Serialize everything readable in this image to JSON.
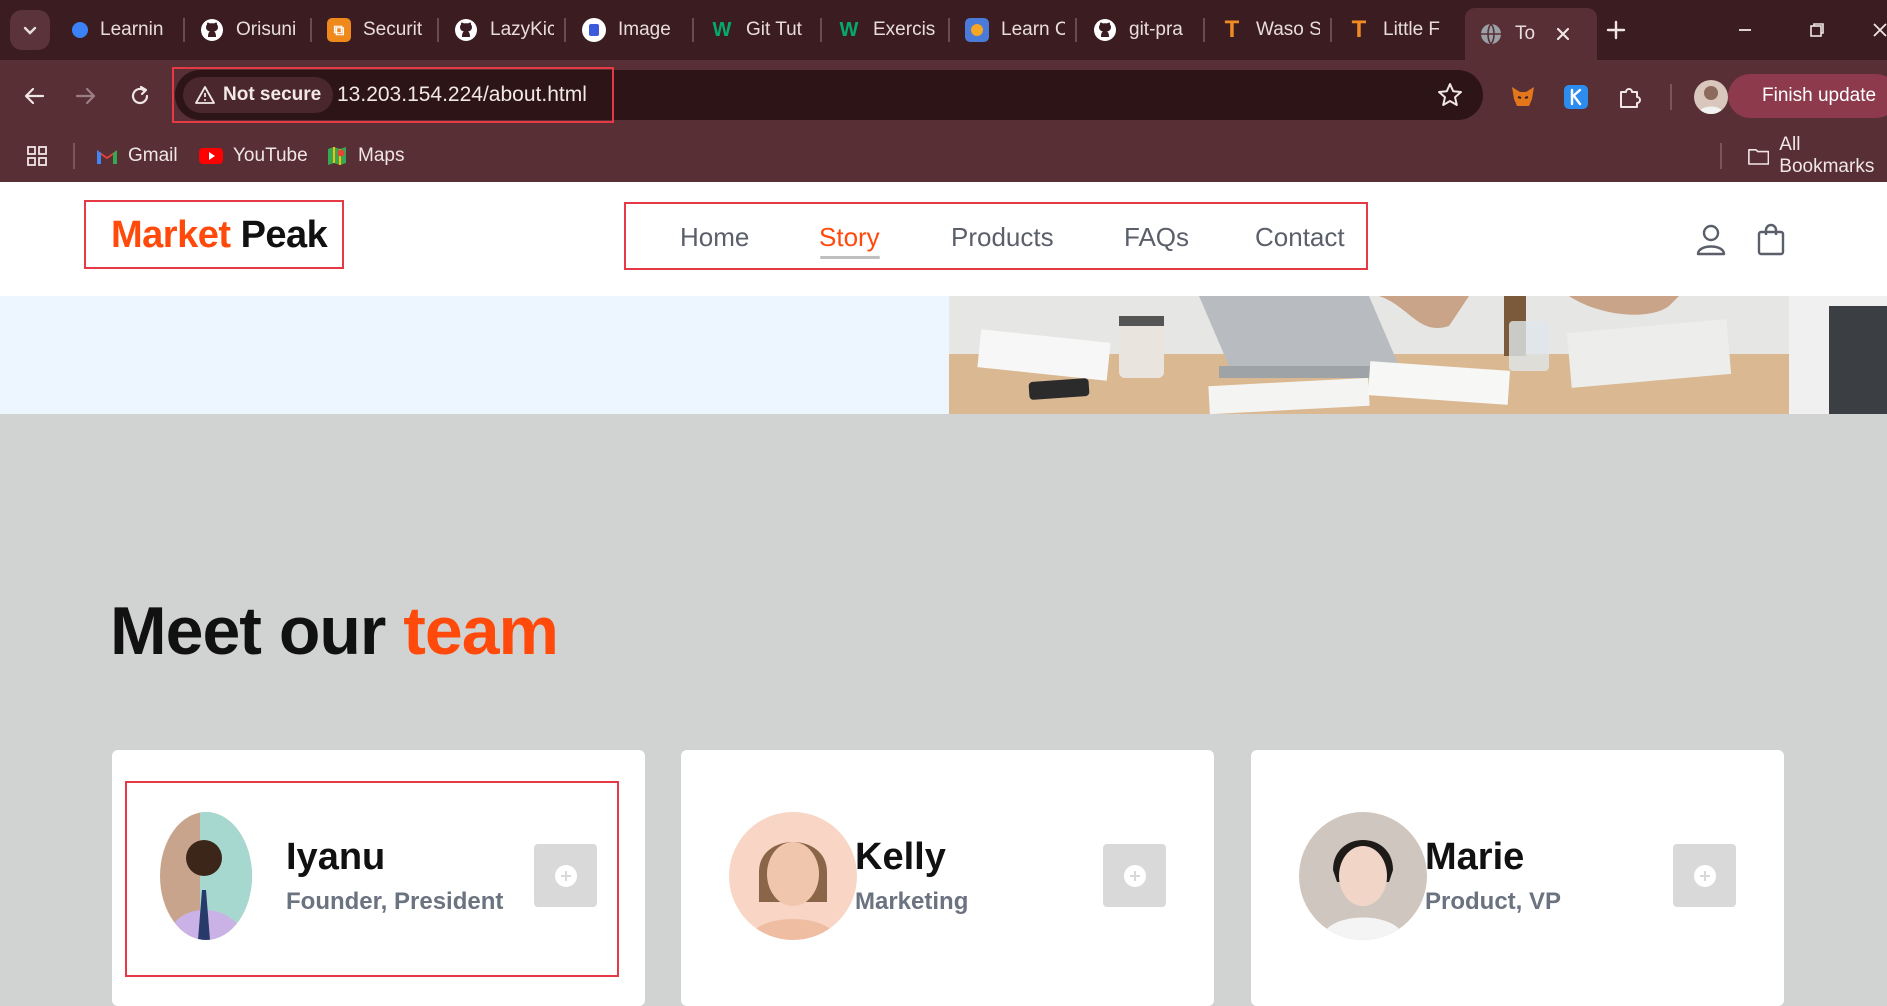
{
  "browser": {
    "tabs": [
      {
        "label": "Learnin",
        "icon": "learning-icon",
        "color": "#3b82f6"
      },
      {
        "label": "Orisuni",
        "icon": "github-icon",
        "color": "#ffffff"
      },
      {
        "label": "Securit",
        "icon": "security-icon",
        "color": "#f0891c"
      },
      {
        "label": "LazyKic",
        "icon": "github-icon",
        "color": "#ffffff"
      },
      {
        "label": "Image",
        "icon": "docs-icon",
        "color": "#ffffff"
      },
      {
        "label": "Git Tut",
        "icon": "w3schools-icon",
        "color": "#04aa6d"
      },
      {
        "label": "Exercis",
        "icon": "w3schools-icon",
        "color": "#04aa6d"
      },
      {
        "label": "Learn C",
        "icon": "learn-icon",
        "color": "#4a7bd8"
      },
      {
        "label": "git-pra",
        "icon": "github-icon",
        "color": "#ffffff"
      },
      {
        "label": "Waso S",
        "icon": "t-icon",
        "color": "#f08a24"
      },
      {
        "label": "Little F",
        "icon": "t-icon",
        "color": "#f08a24"
      }
    ],
    "active_tab": {
      "label": "To"
    },
    "security_label": "Not secure",
    "url": "13.203.154.224/about.html",
    "finish_update": "Finish update",
    "bookmarks": [
      {
        "label": "Gmail"
      },
      {
        "label": "YouTube"
      },
      {
        "label": "Maps"
      }
    ],
    "all_bookmarks": "All Bookmarks"
  },
  "site": {
    "logo_part1": "Market",
    "logo_part2": "Peak",
    "nav": [
      {
        "label": "Home"
      },
      {
        "label": "Story"
      },
      {
        "label": "Products"
      },
      {
        "label": "FAQs"
      },
      {
        "label": "Contact"
      }
    ],
    "active_nav": "Story",
    "team_title_part1": "Meet our",
    "team_title_part2": "team",
    "team": [
      {
        "name": "Iyanu",
        "role": "Founder, President"
      },
      {
        "name": "Kelly",
        "role": "Marketing"
      },
      {
        "name": "Marie",
        "role": "Product, VP"
      }
    ]
  },
  "colors": {
    "accent": "#ff4a0b",
    "highlight": "#e53945",
    "chrome_dark": "#3b1d21",
    "chrome": "#572f35"
  }
}
